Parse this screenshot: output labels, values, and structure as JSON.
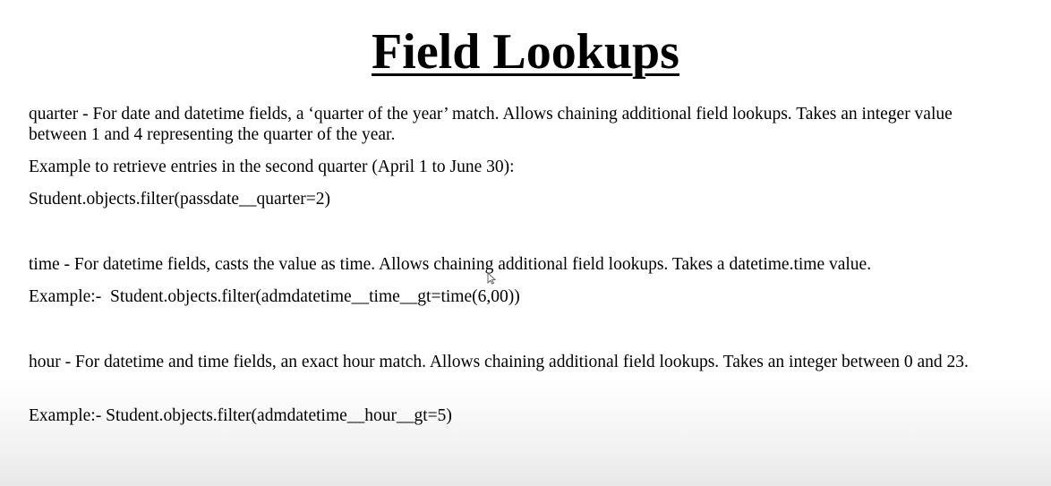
{
  "title": "Field Lookups",
  "sections": {
    "quarter": {
      "description": "quarter - For date and datetime fields, a ‘quarter of the year’ match. Allows chaining additional field lookups. Takes an integer value between 1 and 4 representing the quarter of the year.",
      "example_intro": "Example to retrieve entries in the second quarter (April 1 to June 30):",
      "example_code": "Student.objects.filter(passdate__quarter=2)"
    },
    "time": {
      "description": "time - For datetime fields, casts the value as time. Allows chaining additional field lookups. Takes a datetime.time value.",
      "example": "Example:-  Student.objects.filter(admdatetime__time__gt=time(6,00))"
    },
    "hour": {
      "description": "hour - For datetime and time fields, an exact hour match. Allows chaining additional field lookups. Takes an integer between 0 and 23.",
      "example": "Example:- Student.objects.filter(admdatetime__hour__gt=5)"
    }
  }
}
